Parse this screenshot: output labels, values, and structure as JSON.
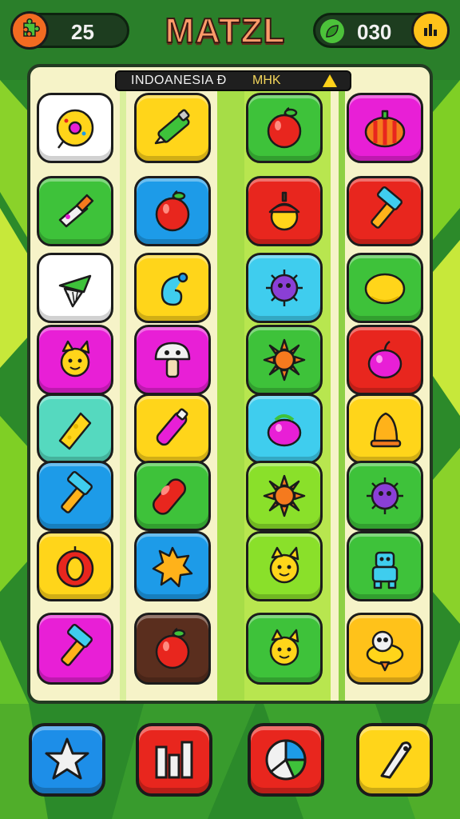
{
  "header": {
    "title": "MATZL",
    "left_counter": "25",
    "right_counter": "030",
    "left_badge_icon": "puzzle-icon",
    "right_badge_icon": "stats-icon"
  },
  "board": {
    "banner_label": "INDOANESIA Ð",
    "banner_tag": "MHK",
    "columns": 4,
    "rows": 8,
    "tiles": [
      {
        "icon": "donut",
        "color": "#ffffff"
      },
      {
        "icon": "pencil",
        "color": "#ffd51a"
      },
      {
        "icon": "apple",
        "color": "#3ec23a"
      },
      {
        "icon": "pumpkin",
        "color": "#e81fd6"
      },
      {
        "icon": "tool",
        "color": "#3ec23a"
      },
      {
        "icon": "apple",
        "color": "#1d9be8"
      },
      {
        "icon": "acorn",
        "color": "#e8261e"
      },
      {
        "icon": "hammer",
        "color": "#e8261e"
      },
      {
        "icon": "shuttlecock",
        "color": "#ffffff"
      },
      {
        "icon": "swirl",
        "color": "#ffd51a"
      },
      {
        "icon": "virus",
        "color": "#3fcdee"
      },
      {
        "icon": "lemon",
        "color": "#3ec23a"
      },
      {
        "icon": "sun-face",
        "color": "#e81fd6"
      },
      {
        "icon": "mushroom",
        "color": "#e81fd6"
      },
      {
        "icon": "sun",
        "color": "#3ec23a"
      },
      {
        "icon": "plum",
        "color": "#e8261e"
      },
      {
        "icon": "cheese",
        "color": "#55d9bf"
      },
      {
        "icon": "tube",
        "color": "#ffd51a"
      },
      {
        "icon": "berry",
        "color": "#3fcdee"
      },
      {
        "icon": "bell",
        "color": "#ffd51a"
      },
      {
        "icon": "hammer",
        "color": "#1d9be8"
      },
      {
        "icon": "capsule",
        "color": "#3ec23a"
      },
      {
        "icon": "sun",
        "color": "#8ae02a"
      },
      {
        "icon": "virus",
        "color": "#3ec23a"
      },
      {
        "icon": "fruit-slice",
        "color": "#ffd51a"
      },
      {
        "icon": "splat",
        "color": "#1d9be8"
      },
      {
        "icon": "sun-face",
        "color": "#8ae02a"
      },
      {
        "icon": "robot",
        "color": "#3ec23a"
      },
      {
        "icon": "hammer",
        "color": "#e81fd6"
      },
      {
        "icon": "apple",
        "color": "#5a2e1e"
      },
      {
        "icon": "sun-face",
        "color": "#3ec23a"
      },
      {
        "icon": "spinning-top",
        "color": "#ffc21a"
      }
    ]
  },
  "bottom_buttons": [
    {
      "name": "star-button",
      "icon": "star-icon",
      "color": "#1d8ee8"
    },
    {
      "name": "leaderboard-button",
      "icon": "bar-chart-icon",
      "color": "#e8261e"
    },
    {
      "name": "stats-button",
      "icon": "pie-chart-icon",
      "color": "#e8261e"
    },
    {
      "name": "edit-button",
      "icon": "pen-icon",
      "color": "#ffd51a"
    }
  ]
}
